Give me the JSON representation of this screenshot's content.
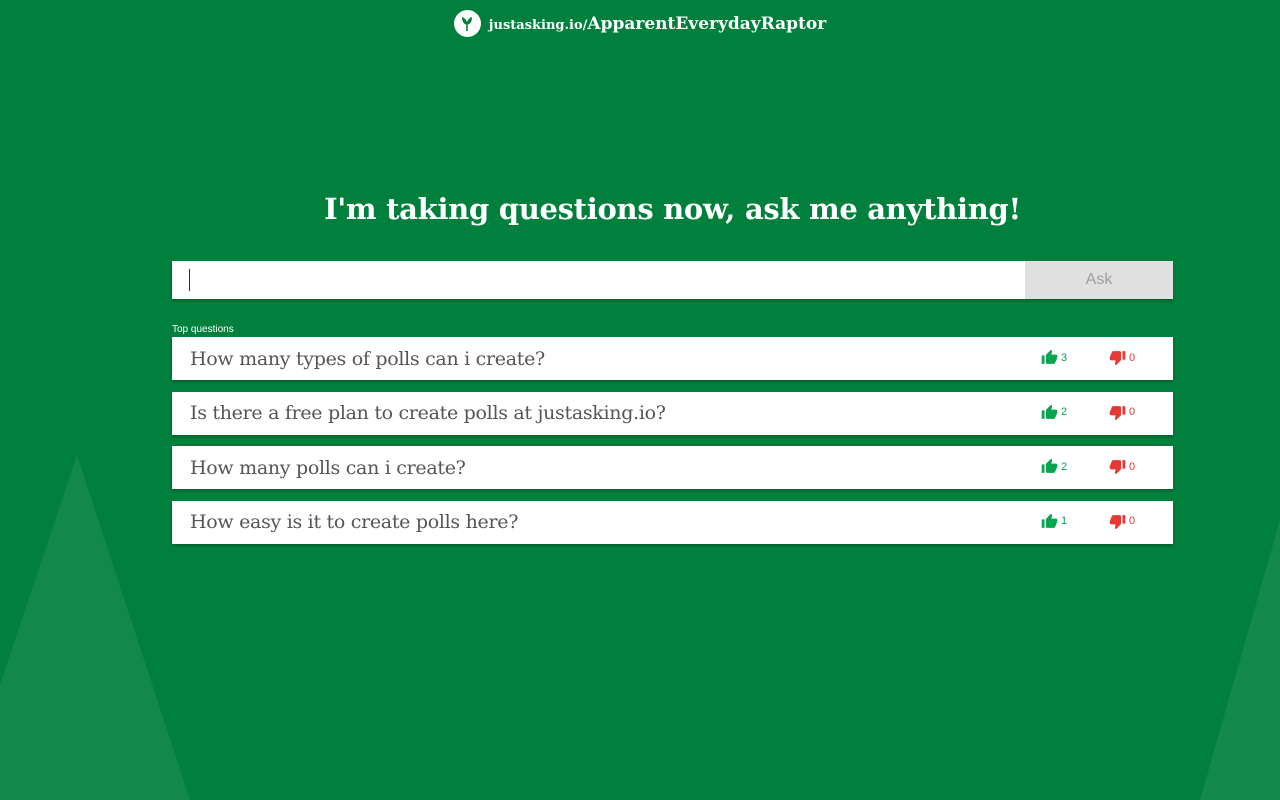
{
  "brand": {
    "domain": "justasking.io",
    "separator": "/",
    "room": "ApparentEverydayRaptor",
    "logo_icon": "justasking-logo-icon"
  },
  "heading": "I'm taking questions now, ask me anything!",
  "ask": {
    "input_value": "",
    "button_label": "Ask"
  },
  "section_label": "Top questions",
  "colors": {
    "background": "#00803c",
    "upvote": "#0aa34f",
    "downvote": "#e53935"
  },
  "questions": [
    {
      "text": "How many types of polls can i create?",
      "up": "3",
      "down": "0"
    },
    {
      "text": "Is there a free plan to create polls at justasking.io?",
      "up": "2",
      "down": "0"
    },
    {
      "text": "How many polls can i create?",
      "up": "2",
      "down": "0"
    },
    {
      "text": "How easy is it to create polls here?",
      "up": "1",
      "down": "0"
    }
  ]
}
